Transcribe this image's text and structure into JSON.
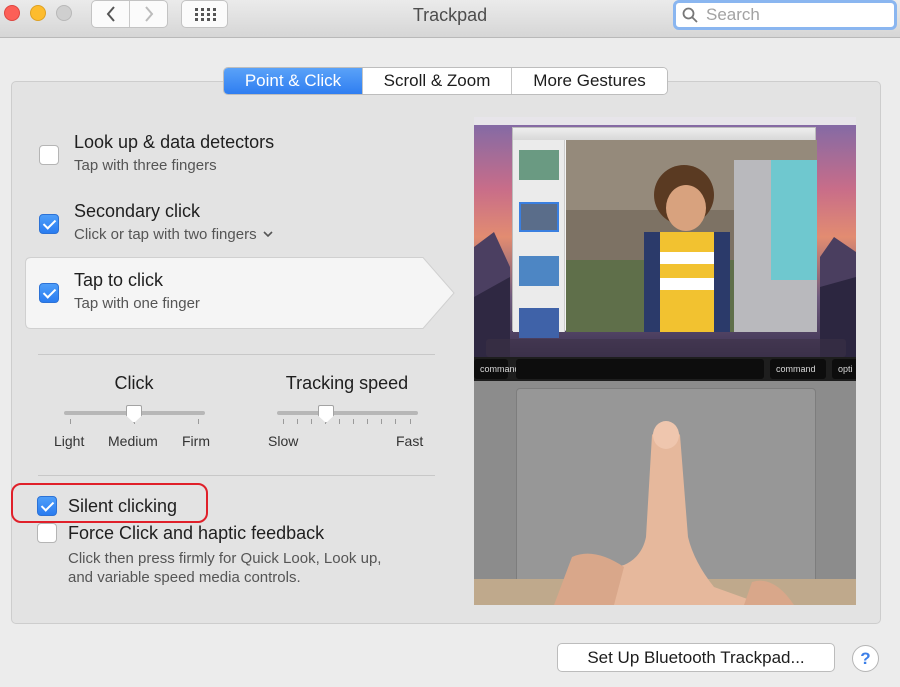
{
  "window": {
    "title": "Trackpad",
    "search_placeholder": "Search"
  },
  "tabs": [
    {
      "label": "Point & Click",
      "active": true
    },
    {
      "label": "Scroll & Zoom",
      "active": false
    },
    {
      "label": "More Gestures",
      "active": false
    }
  ],
  "options": {
    "lookup": {
      "title": "Look up & data detectors",
      "subtitle": "Tap with three fingers",
      "checked": false
    },
    "secondary": {
      "title": "Secondary click",
      "subtitle": "Click or tap with two fingers",
      "checked": true
    },
    "tap": {
      "title": "Tap to click",
      "subtitle": "Tap with one finger",
      "checked": true
    }
  },
  "sliders": {
    "click": {
      "title": "Click",
      "labels": [
        "Light",
        "Medium",
        "Firm"
      ],
      "value": "Medium"
    },
    "tracking": {
      "title": "Tracking speed",
      "min_label": "Slow",
      "max_label": "Fast",
      "value_fraction": 0.35
    }
  },
  "silent": {
    "title": "Silent clicking",
    "checked": true
  },
  "force": {
    "title": "Force Click and haptic feedback",
    "desc1": "Click then press firmly for Quick Look, Look up,",
    "desc2": "and variable speed media controls.",
    "checked": false
  },
  "preview": {
    "keys": {
      "left": "command",
      "right": "command",
      "far_right": "opti"
    }
  },
  "buttons": {
    "bluetooth": "Set Up Bluetooth Trackpad...",
    "help": "?"
  },
  "colors": {
    "accent": "#2f7ef1",
    "annotation": "#e0202a"
  }
}
